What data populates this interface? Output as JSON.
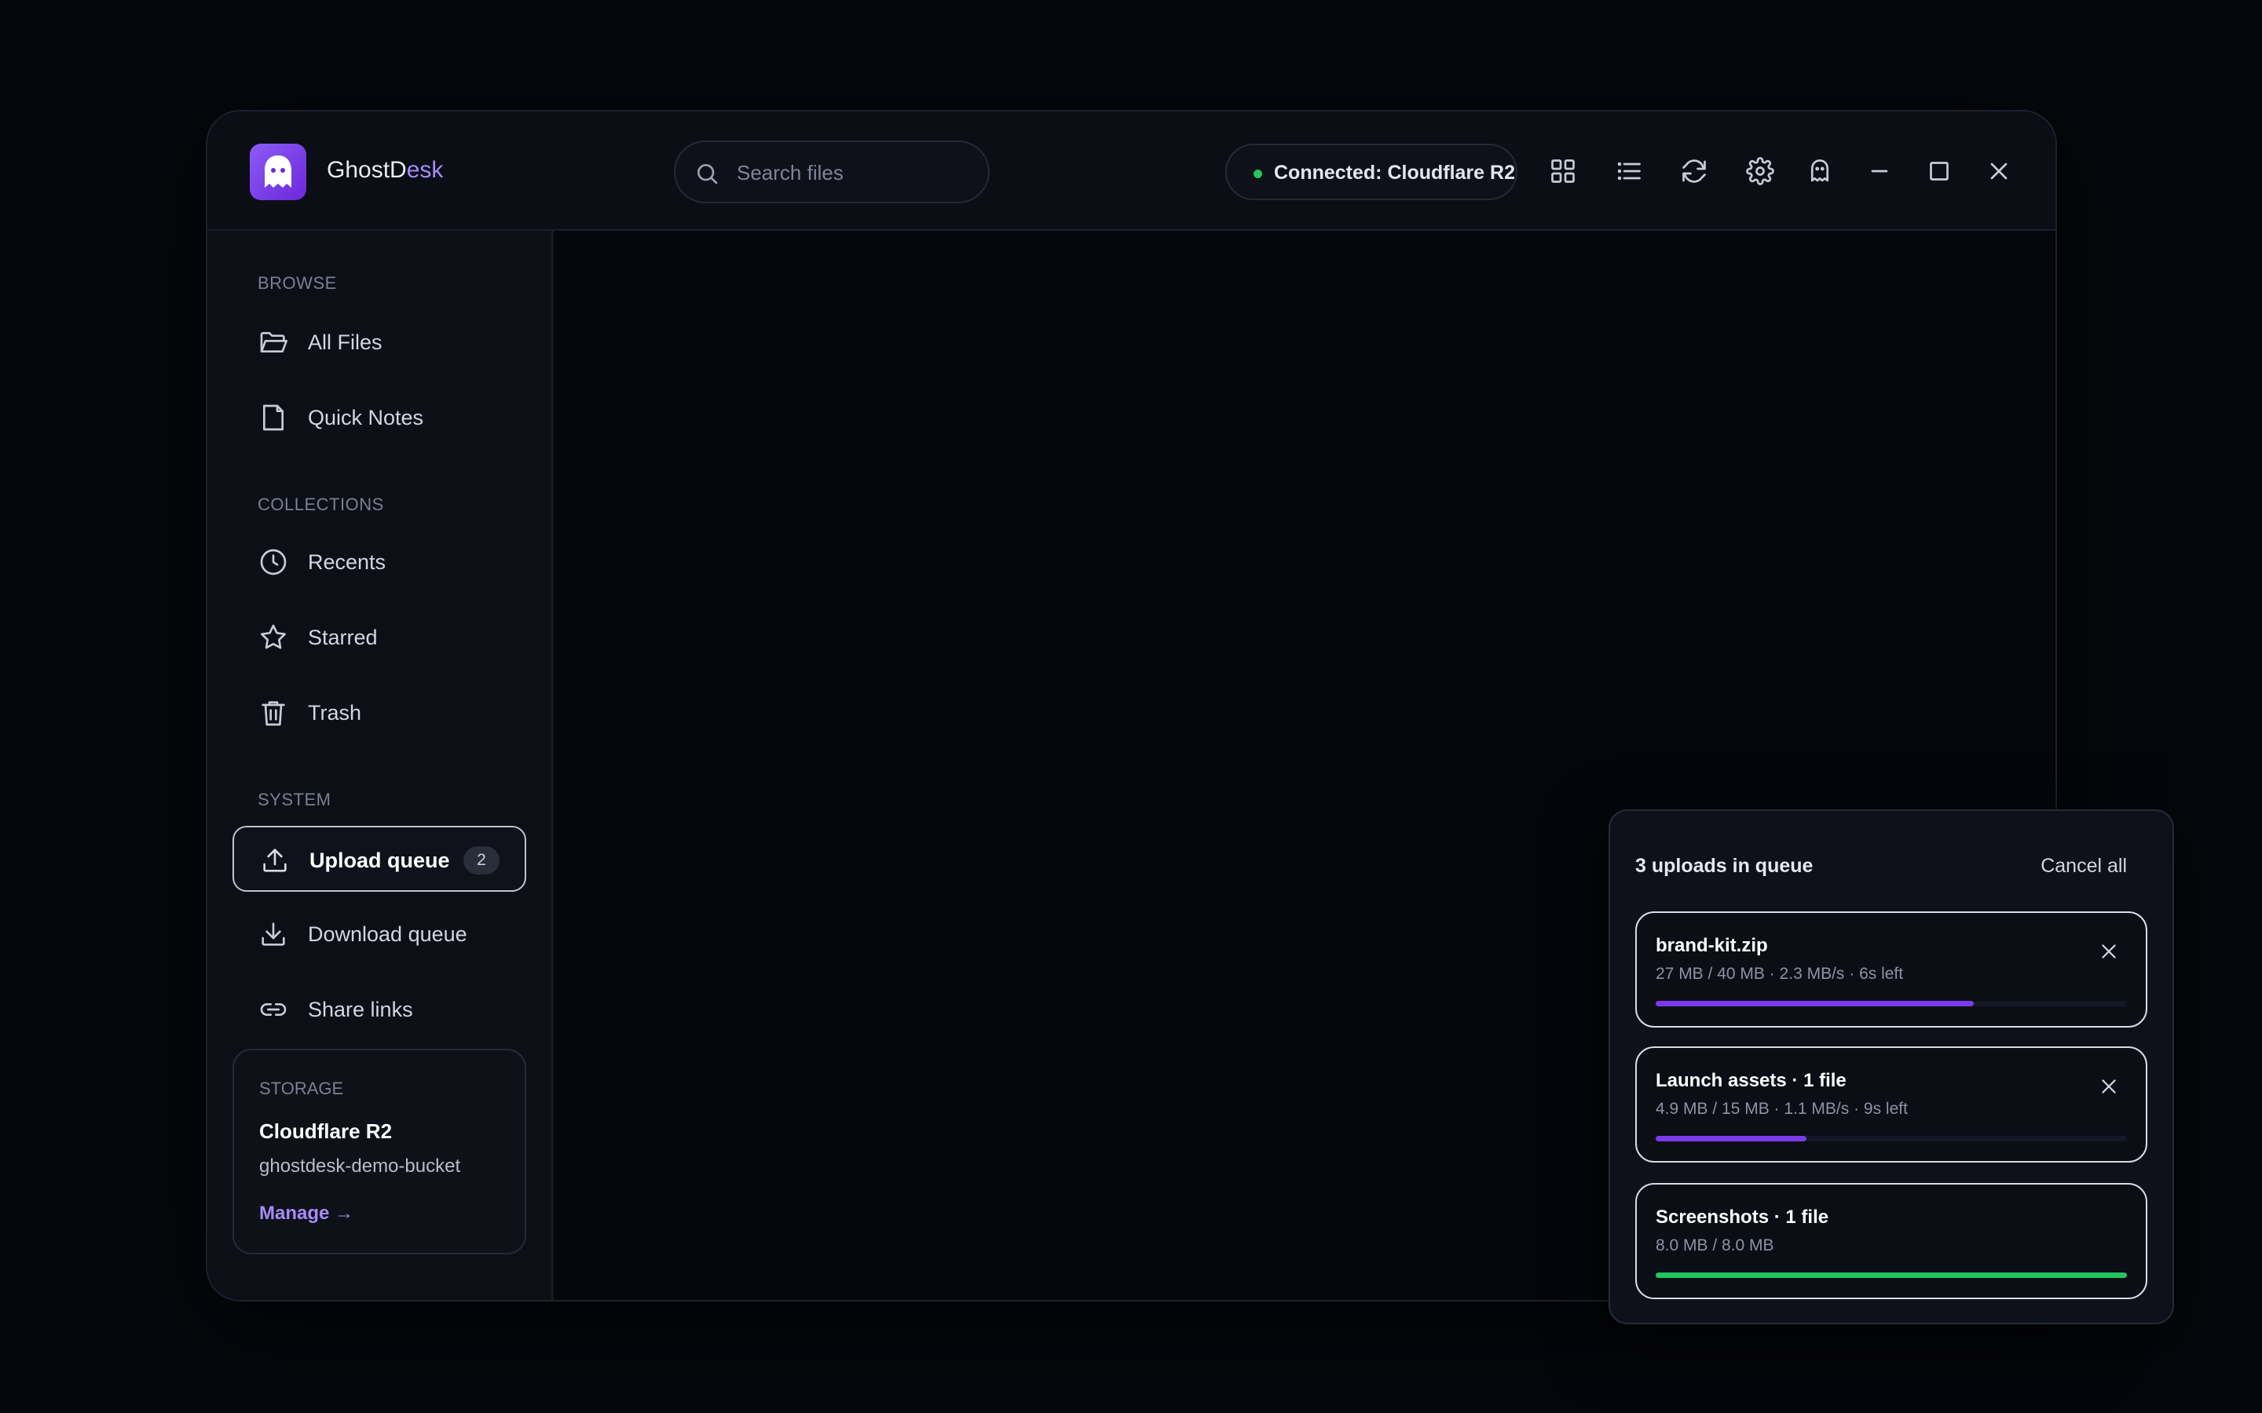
{
  "app": {
    "name_prefix": "GhostD",
    "name_suffix": "esk"
  },
  "search": {
    "placeholder": "Search files"
  },
  "connection": {
    "label": "Connected: Cloudflare R2",
    "status_color": "#22c55e"
  },
  "toolbar": {
    "icons": [
      "grid-view-icon",
      "list-view-icon",
      "refresh-icon",
      "settings-icon",
      "ghost-icon",
      "minimize-icon",
      "maximize-icon",
      "close-icon"
    ]
  },
  "sidebar": {
    "sections": {
      "browse": "BROWSE",
      "collections": "COLLECTIONS",
      "system": "SYSTEM"
    },
    "browse_items": [
      {
        "label": "All Files",
        "icon": "folder-open-icon"
      },
      {
        "label": "Quick Notes",
        "icon": "note-icon"
      }
    ],
    "collection_items": [
      {
        "label": "Recents",
        "icon": "clock-icon"
      },
      {
        "label": "Starred",
        "icon": "star-icon"
      },
      {
        "label": "Trash",
        "icon": "trash-icon"
      }
    ],
    "system_items": [
      {
        "label": "Upload queue",
        "icon": "upload-icon",
        "badge": "2",
        "active": true
      },
      {
        "label": "Download queue",
        "icon": "download-icon"
      },
      {
        "label": "Share links",
        "icon": "link-icon"
      }
    ],
    "storage": {
      "label": "STORAGE",
      "provider": "Cloudflare R2",
      "bucket": "ghostdesk-demo-bucket",
      "manage_label": "Manage →"
    }
  },
  "upload_queue": {
    "title": "3 uploads in queue",
    "cancel_all_label": "Cancel all",
    "items": [
      {
        "name": "brand-kit.zip",
        "meta": "27 MB / 40 MB · 2.3 MB/s · 6s left",
        "progress": 0.675,
        "color": "#7c3aed",
        "cancellable": true
      },
      {
        "name": "Launch assets · 1 file",
        "meta": "4.9 MB / 15 MB · 1.1 MB/s · 9s left",
        "progress": 0.32,
        "color": "#7c3aed",
        "cancellable": true
      },
      {
        "name": "Screenshots · 1 file",
        "meta": "8.0 MB / 8.0 MB",
        "progress": 1.0,
        "color": "#22c55e",
        "cancellable": false
      }
    ]
  },
  "colors": {
    "accent": "#a78bfa",
    "brand": "#8b5cf6",
    "success": "#22c55e",
    "progress": "#7c3aed"
  }
}
